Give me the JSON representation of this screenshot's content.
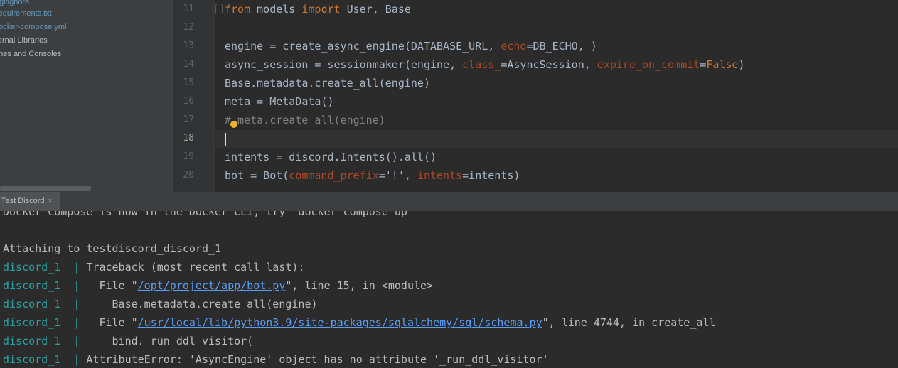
{
  "project_tree": {
    "items": [
      {
        "label": ".gitignore",
        "kind": "file"
      },
      {
        "label": "requirements.txt",
        "kind": "file"
      },
      {
        "label": "docker-compose.yml",
        "kind": "file"
      },
      {
        "label": "External Libraries",
        "kind": "folder"
      },
      {
        "label": "Scratches and Consoles",
        "kind": "folder"
      }
    ]
  },
  "editor": {
    "line_numbers": [
      "11",
      "12",
      "13",
      "14",
      "15",
      "16",
      "17",
      "18",
      "19",
      "20"
    ],
    "current_line": "18",
    "lines": [
      {
        "segments": [
          {
            "t": "from",
            "c": "kw"
          },
          {
            "t": " models ",
            "c": ""
          },
          {
            "t": "import",
            "c": "kw"
          },
          {
            "t": " User, Base",
            "c": ""
          }
        ]
      },
      {
        "segments": []
      },
      {
        "segments": [
          {
            "t": "engine = create_async_engine(DATABASE_URL, ",
            "c": ""
          },
          {
            "t": "echo",
            "c": "param"
          },
          {
            "t": "=DB_ECHO, )",
            "c": ""
          }
        ]
      },
      {
        "segments": [
          {
            "t": "async_session = sessionmaker(engine, ",
            "c": ""
          },
          {
            "t": "class_",
            "c": "param"
          },
          {
            "t": "=AsyncSession, ",
            "c": ""
          },
          {
            "t": "expire_on_commit",
            "c": "param"
          },
          {
            "t": "=",
            "c": ""
          },
          {
            "t": "False",
            "c": "kw"
          },
          {
            "t": ")",
            "c": ""
          }
        ]
      },
      {
        "segments": [
          {
            "t": "Base.metadata.create_all(engine)",
            "c": ""
          }
        ]
      },
      {
        "segments": [
          {
            "t": "meta = MetaData()",
            "c": ""
          }
        ]
      },
      {
        "segments": [
          {
            "t": "# meta.create_all(engine)",
            "c": "comment"
          }
        ]
      },
      {
        "segments": []
      },
      {
        "segments": [
          {
            "t": "intents = discord.Intents().all()",
            "c": ""
          }
        ]
      },
      {
        "segments": [
          {
            "t": "bot = Bot(",
            "c": ""
          },
          {
            "t": "command_prefix",
            "c": "param"
          },
          {
            "t": "='!', ",
            "c": ""
          },
          {
            "t": "intents",
            "c": "param"
          },
          {
            "t": "=intents)",
            "c": ""
          }
        ]
      }
    ]
  },
  "tool_window": {
    "tab_label": "Test Discord",
    "close_glyph": "×"
  },
  "console": {
    "lines": [
      {
        "prefix": "",
        "text": "Docker Compose is now in the Docker CLI, try `docker compose up`"
      },
      {
        "prefix": "",
        "text": ""
      },
      {
        "prefix": "",
        "text": "Attaching to testdiscord_discord_1"
      },
      {
        "prefix": "discord_1  | ",
        "text": "Traceback (most recent call last):"
      },
      {
        "prefix": "discord_1  | ",
        "text": "  File \"",
        "link": "/opt/project/app/bot.py",
        "after": "\", line 15, in <module>"
      },
      {
        "prefix": "discord_1  | ",
        "text": "    Base.metadata.create_all(engine)"
      },
      {
        "prefix": "discord_1  | ",
        "text": "  File \"",
        "link": "/usr/local/lib/python3.9/site-packages/sqlalchemy/sql/schema.py",
        "after": "\", line 4744, in create_all"
      },
      {
        "prefix": "discord_1  | ",
        "text": "    bind._run_ddl_visitor("
      },
      {
        "prefix": "discord_1  | ",
        "text": "AttributeError: 'AsyncEngine' object has no attribute '_run_ddl_visitor'"
      }
    ]
  },
  "colors": {
    "editor_bg": "#2b2b2b",
    "keyword": "#cc7832",
    "param": "#aa4926",
    "service_prefix": "#2aa1a1",
    "link": "#589df6"
  }
}
